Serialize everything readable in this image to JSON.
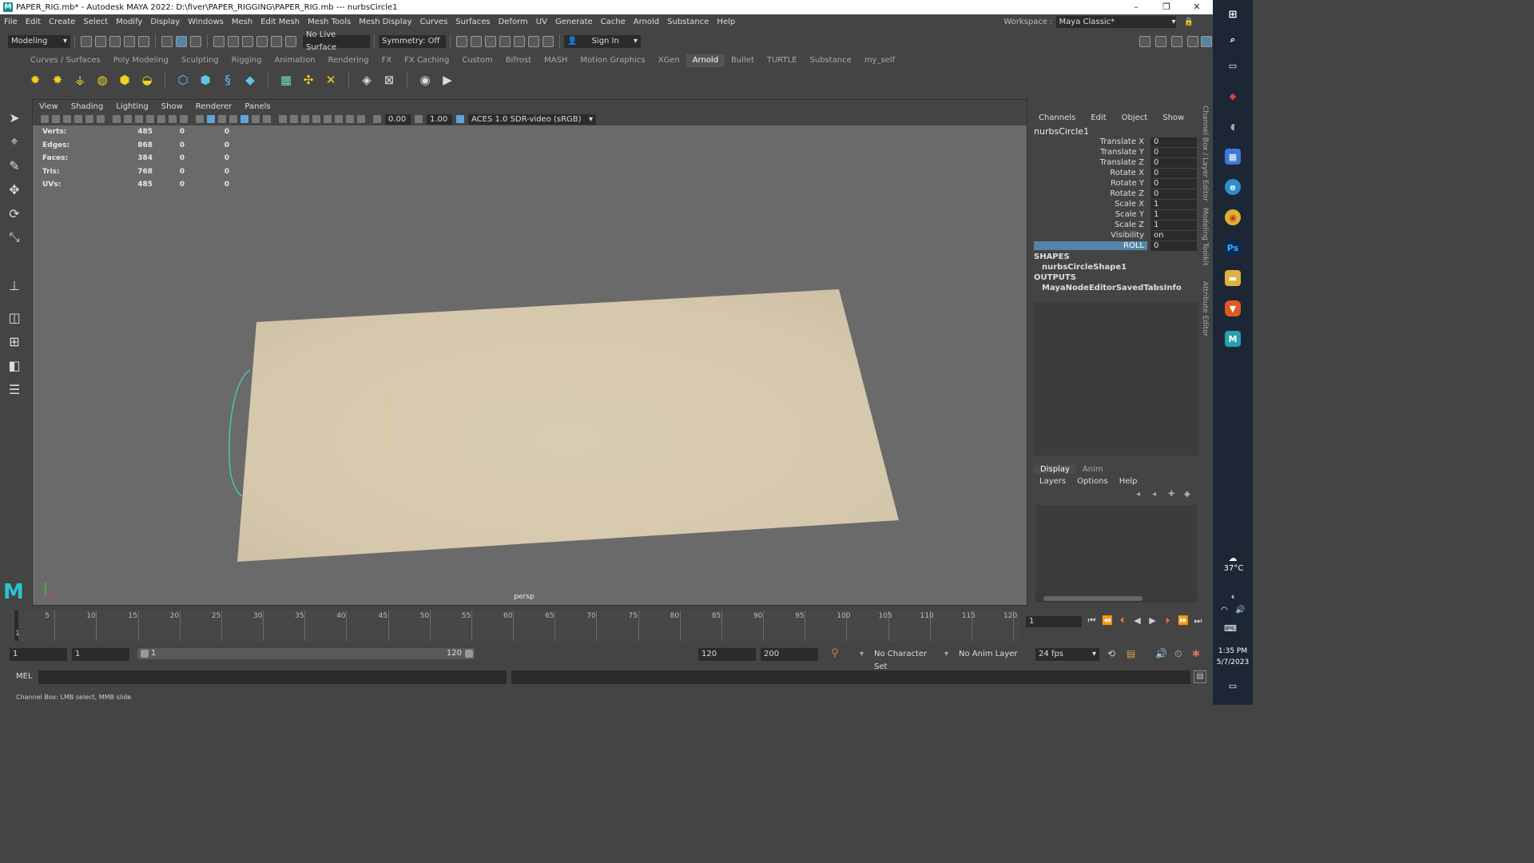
{
  "window": {
    "title": "PAPER_RIG.mb* - Autodesk MAYA 2022: D:\\fiver\\PAPER_RIGGING\\PAPER_RIG.mb   ---   nurbsCircle1",
    "logo": "M",
    "controls": [
      "–",
      "❐",
      "✕"
    ]
  },
  "menubar": {
    "items": [
      "File",
      "Edit",
      "Create",
      "Select",
      "Modify",
      "Display",
      "Windows",
      "Mesh",
      "Edit Mesh",
      "Mesh Tools",
      "Mesh Display",
      "Curves",
      "Surfaces",
      "Deform",
      "UV",
      "Generate",
      "Cache",
      "Arnold",
      "Substance",
      "Help"
    ],
    "workspace_label": "Workspace :",
    "workspace_value": "Maya Classic*"
  },
  "toolbar": {
    "mode": "Modeling",
    "live_surface": "No Live Surface",
    "symmetry": "Symmetry: Off",
    "sign_in": "Sign In"
  },
  "shelf": {
    "tabs": [
      "Curves / Surfaces",
      "Poly Modeling",
      "Sculpting",
      "Rigging",
      "Animation",
      "Rendering",
      "FX",
      "FX Caching",
      "Custom",
      "Bifrost",
      "MASH",
      "Motion Graphics",
      "XGen",
      "Arnold",
      "Bullet",
      "TURTLE",
      "Substance",
      "my_self"
    ],
    "active_tab": "Arnold",
    "icons": [
      "area-light-icon",
      "sky-dome-light-icon",
      "photometric-light-icon",
      "physical-sky-icon",
      "mesh-light-icon",
      "light-portal-icon",
      "standin-icon",
      "volume-icon",
      "curve-collector-icon",
      "procedural-icon",
      "uv-checker-icon",
      "texture-icon",
      "tx-manager-icon",
      "flush-icon",
      "clean-icon",
      "render-view-icon",
      "render-icon"
    ]
  },
  "viewport": {
    "menu": [
      "View",
      "Shading",
      "Lighting",
      "Show",
      "Renderer",
      "Panels"
    ],
    "exposure": "0.00",
    "gamma": "1.00",
    "color_space": "ACES 1.0 SDR-video (sRGB)",
    "camera": "persp",
    "hud": [
      {
        "label": "Verts:",
        "v1": "485",
        "v2": "0",
        "v3": "0"
      },
      {
        "label": "Edges:",
        "v1": "868",
        "v2": "0",
        "v3": "0"
      },
      {
        "label": "Faces:",
        "v1": "384",
        "v2": "0",
        "v3": "0"
      },
      {
        "label": "Tris:",
        "v1": "768",
        "v2": "0",
        "v3": "0"
      },
      {
        "label": "UVs:",
        "v1": "485",
        "v2": "0",
        "v3": "0"
      }
    ],
    "paper_color": "#d9cdb5",
    "curve_color": "#3fd6b0"
  },
  "channel_box": {
    "menu": [
      "Channels",
      "Edit",
      "Object",
      "Show"
    ],
    "node": "nurbsCircle1",
    "attributes": [
      {
        "label": "Translate X",
        "value": "0"
      },
      {
        "label": "Translate Y",
        "value": "0"
      },
      {
        "label": "Translate Z",
        "value": "0"
      },
      {
        "label": "Rotate X",
        "value": "0"
      },
      {
        "label": "Rotate Y",
        "value": "0"
      },
      {
        "label": "Rotate Z",
        "value": "0"
      },
      {
        "label": "Scale X",
        "value": "1"
      },
      {
        "label": "Scale Y",
        "value": "1"
      },
      {
        "label": "Scale Z",
        "value": "1"
      },
      {
        "label": "Visibility",
        "value": "on"
      },
      {
        "label": "ROLL",
        "value": "0"
      }
    ],
    "shapes_header": "SHAPES",
    "shape": "nurbsCircleShape1",
    "outputs_header": "OUTPUTS",
    "output": "MayaNodeEditorSavedTabsInfo",
    "side_tabs": [
      "Channel Box / Layer Editor",
      "Modeling Toolkit",
      "Attribute Editor"
    ]
  },
  "layer_editor": {
    "tabs": [
      "Display",
      "Anim"
    ],
    "active_tab": "Display",
    "menu": [
      "Layers",
      "Options",
      "Help"
    ]
  },
  "timeline": {
    "ticks": [
      "5",
      "10",
      "15",
      "20",
      "25",
      "30",
      "35",
      "40",
      "45",
      "50",
      "55",
      "60",
      "65",
      "70",
      "75",
      "80",
      "85",
      "90",
      "95",
      "100",
      "105",
      "110",
      "115",
      "120"
    ],
    "start_marker": "1",
    "current_frame": "1"
  },
  "range": {
    "start": "1",
    "playback_start": "1",
    "slider_start": "1",
    "slider_end": "120",
    "playback_end": "120",
    "end": "200",
    "character_set": "No Character Set",
    "anim_layer": "No Anim Layer",
    "fps": "24 fps"
  },
  "command_line": {
    "label": "MEL"
  },
  "status_line": "Channel Box: LMB select, MMB slide",
  "taskbar": {
    "weather_temp": "37°C",
    "time": "1:35 PM",
    "date": "5/7/2023"
  }
}
